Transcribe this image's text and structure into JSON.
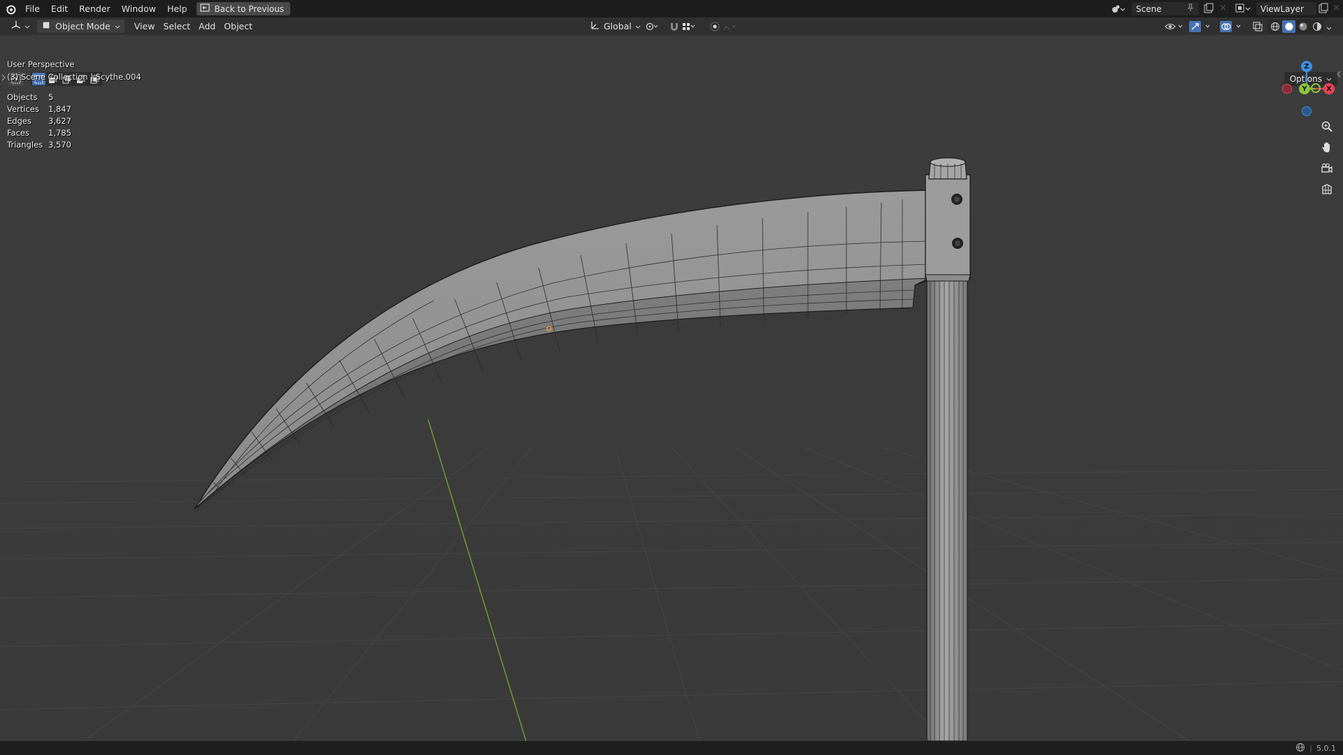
{
  "topbar": {
    "menus": [
      "File",
      "Edit",
      "Render",
      "Window",
      "Help"
    ],
    "back_label": "Back to Previous",
    "scene_label": "Scene",
    "viewlayer_label": "ViewLayer"
  },
  "header": {
    "mode_label": "Object Mode",
    "menus": [
      "View",
      "Select",
      "Add",
      "Object"
    ],
    "transform_orientation": "Global",
    "options_label": "Options"
  },
  "viewport": {
    "perspective_label": "User Perspective",
    "collection_label": "(3) Scene Collection | Scythe.004",
    "stats": [
      {
        "label": "Objects",
        "value": "5"
      },
      {
        "label": "Vertices",
        "value": "1,847"
      },
      {
        "label": "Edges",
        "value": "3,627"
      },
      {
        "label": "Faces",
        "value": "1,785"
      },
      {
        "label": "Triangles",
        "value": "3,570"
      }
    ],
    "gizmo": {
      "x": "X",
      "y": "Y",
      "z": "Z"
    }
  },
  "statusbar": {
    "version": "5.0.1"
  },
  "colors": {
    "accent": "#4772b3",
    "axis_x": "#e8445a",
    "axis_y": "#8bc43a",
    "axis_z": "#3f8fe0"
  }
}
